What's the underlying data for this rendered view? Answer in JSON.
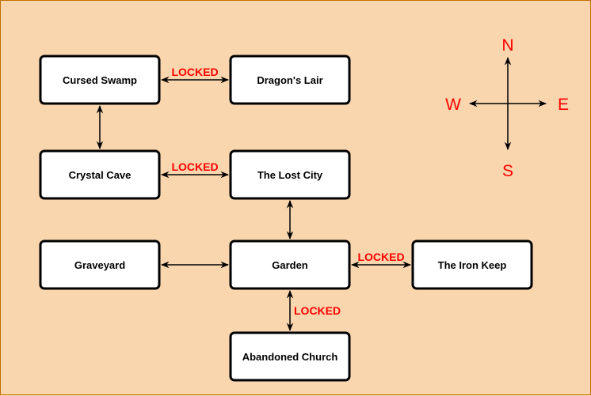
{
  "diagram": {
    "background_color": "#f9d6ae",
    "label_color": "#ff0000",
    "rooms": [
      {
        "id": "cursed-swamp",
        "label": "Cursed Swamp"
      },
      {
        "id": "dragons-lair",
        "label": "Dragon's Lair"
      },
      {
        "id": "crystal-cave",
        "label": "Crystal Cave"
      },
      {
        "id": "lost-city",
        "label": "The Lost City"
      },
      {
        "id": "graveyard",
        "label": "Graveyard"
      },
      {
        "id": "garden",
        "label": "Garden"
      },
      {
        "id": "iron-keep",
        "label": "The Iron Keep"
      },
      {
        "id": "abandoned-church",
        "label": "Abandoned Church"
      }
    ],
    "connections": [
      {
        "from": "cursed-swamp",
        "to": "dragons-lair",
        "label": "LOCKED"
      },
      {
        "from": "cursed-swamp",
        "to": "crystal-cave",
        "label": ""
      },
      {
        "from": "crystal-cave",
        "to": "lost-city",
        "label": "LOCKED"
      },
      {
        "from": "lost-city",
        "to": "garden",
        "label": ""
      },
      {
        "from": "graveyard",
        "to": "garden",
        "label": ""
      },
      {
        "from": "garden",
        "to": "iron-keep",
        "label": "LOCKED"
      },
      {
        "from": "garden",
        "to": "abandoned-church",
        "label": "LOCKED"
      }
    ],
    "compass": {
      "north": "N",
      "south": "S",
      "east": "E",
      "west": "W"
    }
  }
}
